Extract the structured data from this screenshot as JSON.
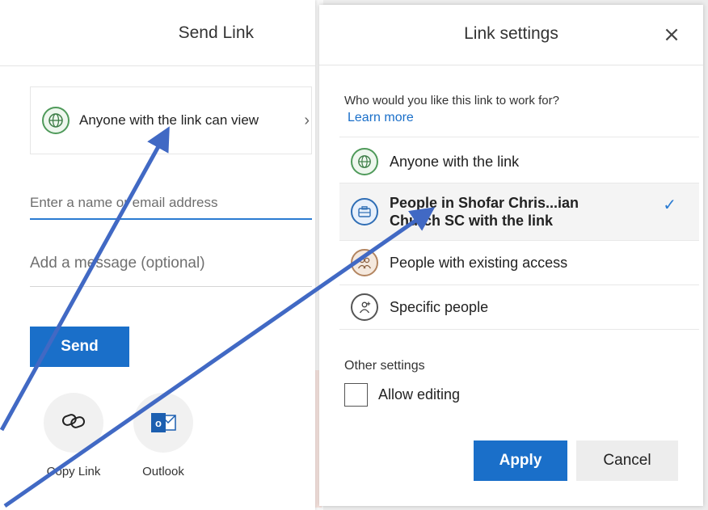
{
  "send_link": {
    "title": "Send Link",
    "scope_text": "Anyone with the link can view",
    "name_placeholder": "Enter a name or email address",
    "message_placeholder": "Add a message (optional)",
    "send_label": "Send",
    "copy_link_label": "Copy Link",
    "outlook_label": "Outlook",
    "outlook_letter": "o"
  },
  "link_settings": {
    "title": "Link settings",
    "close_symbol": "×",
    "question": "Who would you like this link to work for?",
    "learn_more": "Learn more",
    "options": [
      {
        "label": "Anyone with the link",
        "icon": "globe-icon",
        "selected": false
      },
      {
        "label": "People in Shofar Chris...ian Church SC with the link",
        "label_line1": "People in Shofar Chris...ian",
        "label_line2": "Church SC with the link",
        "icon": "briefcase-icon",
        "selected": true
      },
      {
        "label": "People with existing access",
        "icon": "people-icon",
        "selected": false
      },
      {
        "label": "Specific people",
        "icon": "person-add-icon",
        "selected": false
      }
    ],
    "check_symbol": "✓",
    "other_settings": "Other settings",
    "allow_editing": "Allow editing",
    "allow_editing_checked": false,
    "apply_label": "Apply",
    "cancel_label": "Cancel"
  },
  "colors": {
    "accent": "#1a6fc9",
    "arrow": "#4169c4",
    "globe": "#4f9a5a"
  }
}
